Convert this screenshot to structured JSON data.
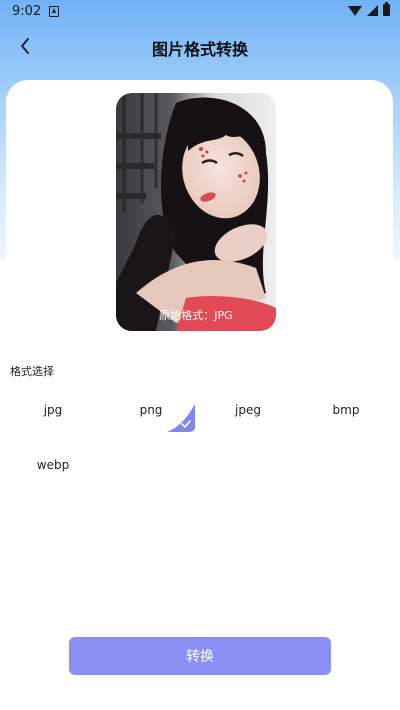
{
  "status_bar": {
    "time": "9:02",
    "icons": [
      "notification-a-icon",
      "wifi-icon",
      "signal-icon",
      "battery-icon"
    ]
  },
  "header": {
    "title": "图片格式转换",
    "back_icon": "chevron-left-icon"
  },
  "preview": {
    "caption": "原始格式：JPG"
  },
  "format_section": {
    "label": "格式选择",
    "selected": "png",
    "options": [
      {
        "label": "jpg"
      },
      {
        "label": "png"
      },
      {
        "label": "jpeg"
      },
      {
        "label": "bmp"
      },
      {
        "label": "webp"
      }
    ]
  },
  "actions": {
    "convert_label": "转换"
  },
  "colors": {
    "accent": "#8c90f4",
    "header_gradient_top": "#6fb2f6",
    "text": "#222222"
  }
}
